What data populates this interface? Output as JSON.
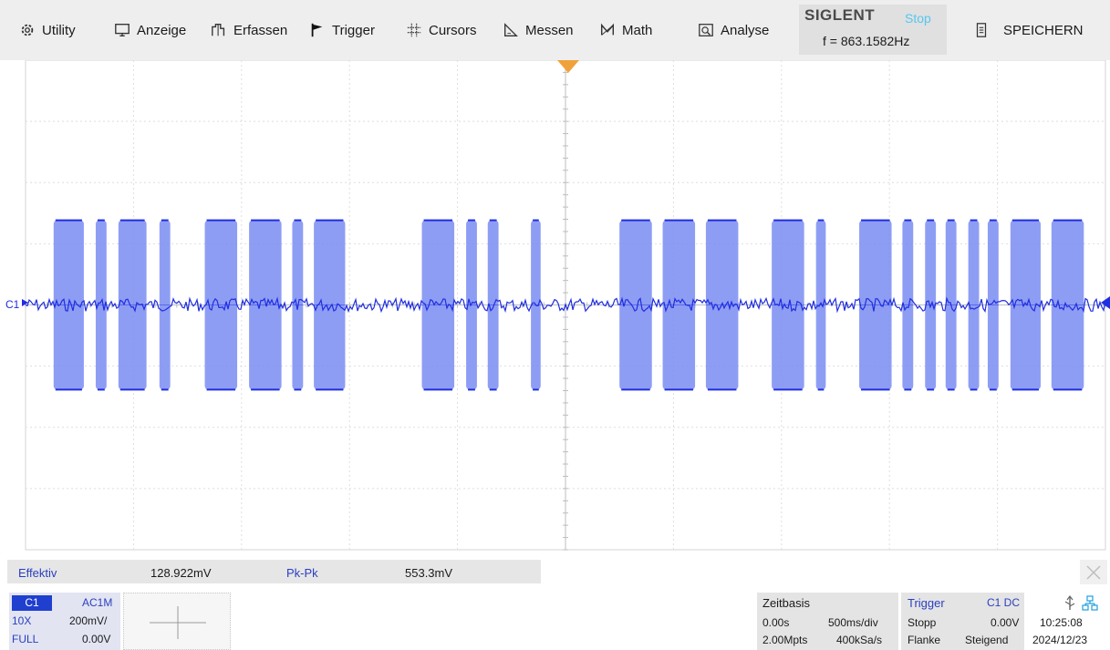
{
  "menu": {
    "items": [
      {
        "label": "Utility",
        "icon": "gear-icon"
      },
      {
        "label": "Anzeige",
        "icon": "monitor-icon"
      },
      {
        "label": "Erfassen",
        "icon": "acquire-icon"
      },
      {
        "label": "Trigger",
        "icon": "flag-icon"
      },
      {
        "label": "Cursors",
        "icon": "cursors-icon"
      },
      {
        "label": "Messen",
        "icon": "measure-icon"
      },
      {
        "label": "Math",
        "icon": "math-icon"
      },
      {
        "label": "Analyse",
        "icon": "analyse-icon"
      }
    ],
    "save": {
      "label": "SPEICHERN",
      "icon": "document-icon"
    }
  },
  "brand": {
    "logo": "SIGLENT",
    "status": "Stop",
    "frequency": "f = 863.1582Hz"
  },
  "screen": {
    "channel_marker": "C1",
    "trace_color": "#1f2ee0",
    "burst_color": "#7a8cf2",
    "trigger_marker_color": "#f0a23a"
  },
  "measurements": [
    {
      "label": "Effektiv",
      "value": "128.922mV"
    },
    {
      "label": "Pk-Pk",
      "value": "553.3mV"
    }
  ],
  "channel": {
    "name": "C1",
    "coupling": "AC1M",
    "probe": "10X",
    "volts_div": "200mV/",
    "bandwidth": "FULL",
    "offset": "0.00V"
  },
  "timebase": {
    "title": "Zeitbasis",
    "delay": "0.00s",
    "time_div": "500ms/div",
    "memory": "2.00Mpts",
    "sample_rate": "400kSa/s"
  },
  "trigger": {
    "title": "Trigger",
    "source": "C1 DC",
    "mode": "Stopp",
    "level": "0.00V",
    "type": "Flanke",
    "slope": "Steigend"
  },
  "clock": {
    "time": "10:25:08",
    "date": "2024/12/23"
  }
}
